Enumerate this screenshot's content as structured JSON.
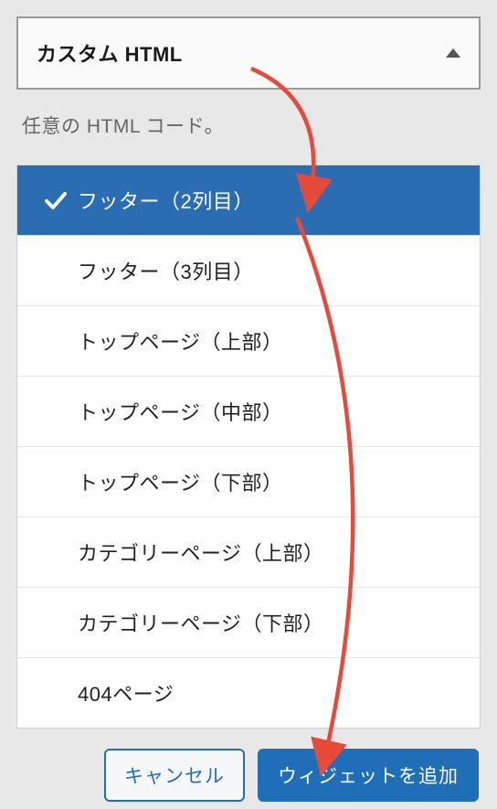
{
  "header": {
    "title": "カスタム HTML"
  },
  "description": "任意の HTML コード。",
  "areas": [
    {
      "label": "フッター（2列目）",
      "selected": true
    },
    {
      "label": "フッター（3列目）",
      "selected": false
    },
    {
      "label": "トップページ（上部）",
      "selected": false
    },
    {
      "label": "トップページ（中部）",
      "selected": false
    },
    {
      "label": "トップページ（下部）",
      "selected": false
    },
    {
      "label": "カテゴリーページ（上部）",
      "selected": false
    },
    {
      "label": "カテゴリーページ（下部）",
      "selected": false
    },
    {
      "label": "404ページ",
      "selected": false
    }
  ],
  "buttons": {
    "cancel": "キャンセル",
    "add": "ウィジェットを追加"
  },
  "colors": {
    "primary": "#1e6fb8",
    "selected_bg": "#2a6db3",
    "annotation": "#e84a3a"
  }
}
